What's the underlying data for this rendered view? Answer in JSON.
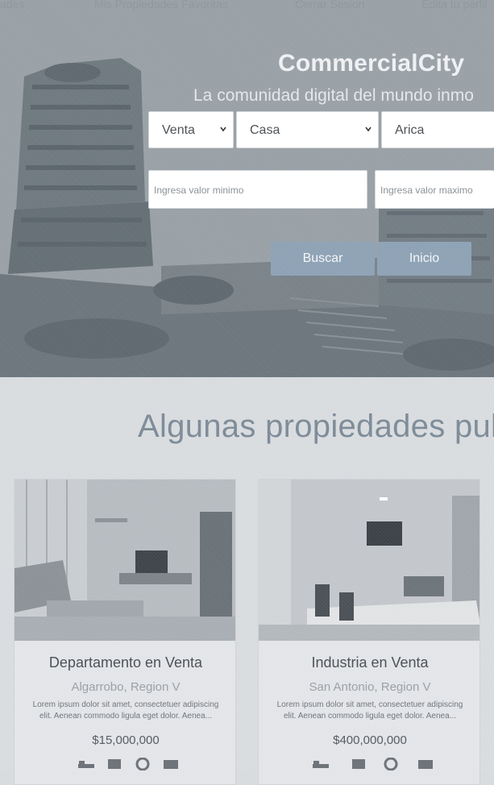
{
  "nav": {
    "items": [
      "ades",
      "Mis Propiedades Favoritas",
      "Cerrar Sesion",
      "Edita tu perfil"
    ]
  },
  "hero": {
    "brand": "CommercialCity",
    "tagline": "La comunidad digital del mundo inmo",
    "filters": {
      "operation": "Venta",
      "type": "Casa",
      "city": "Arica"
    },
    "min_placeholder": "Ingresa valor minimo",
    "max_placeholder": "Ingresa valor maximo",
    "search_label": "Buscar",
    "home_label": "Inicio"
  },
  "section": {
    "title": "Algunas propiedades pub"
  },
  "listings": [
    {
      "title": "Departamento en Venta",
      "location": "Algarrobo, Region V",
      "description": "Lorem ipsum dolor sit amet, consectetuer adipiscing elit. Aenean commodo ligula eget dolor. Aenea...",
      "price": "$15,000,000"
    },
    {
      "title": "Industria en Venta",
      "location": "San Antonio, Region V",
      "description": "Lorem ipsum dolor sit amet, consectetuer adipiscing elit. Aenean commodo ligula eget dolor. Aenea...",
      "price": "$400,000,000"
    }
  ],
  "amenity_icons": [
    "bed-icon",
    "bath-icon",
    "car-icon",
    "area-icon"
  ],
  "colors": {
    "button": "#8ea2b5",
    "heading": "#7d8b98",
    "brand": "#eef0f2"
  }
}
